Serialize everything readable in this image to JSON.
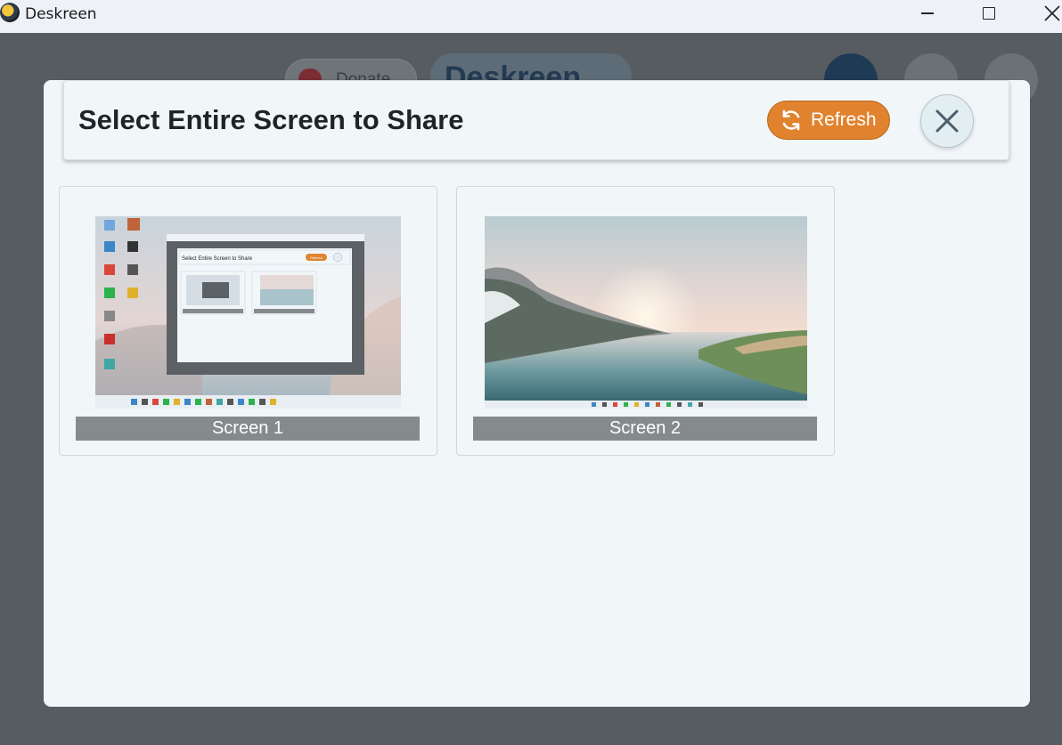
{
  "window": {
    "title": "Deskreen"
  },
  "background_app": {
    "donate_label": "Donate",
    "brand_label": "Deskreen"
  },
  "modal": {
    "title": "Select Entire Screen to Share",
    "refresh_label": "Refresh",
    "screens": [
      {
        "label": "Screen 1"
      },
      {
        "label": "Screen 2"
      }
    ]
  },
  "thumbnail_1": {
    "inner_title": "Select Entire Screen to Share",
    "inner_refresh": "Refresh"
  },
  "colors": {
    "accent": "#e1822e",
    "modal_bg": "#f1f7f9",
    "label_bg": "#858a8c"
  }
}
